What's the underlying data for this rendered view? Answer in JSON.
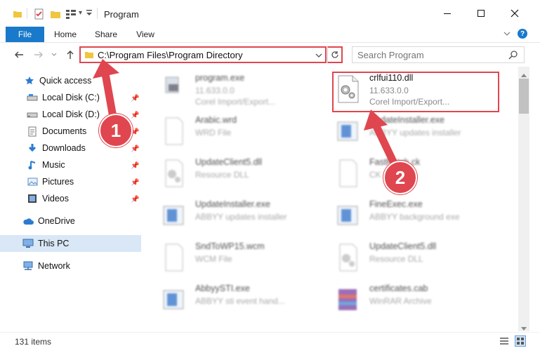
{
  "window": {
    "title": "Program",
    "qa_dropdown": "▾"
  },
  "ribbon": {
    "tabs": [
      {
        "label": "File"
      },
      {
        "label": "Home"
      },
      {
        "label": "Share"
      },
      {
        "label": "View"
      }
    ]
  },
  "address": {
    "path": "C:\\Program Files\\Program Directory"
  },
  "search": {
    "placeholder": "Search Program"
  },
  "nav": {
    "items": [
      {
        "label": "Quick access",
        "icon": "star-icon"
      },
      {
        "label": "Local Disk (C:)",
        "icon": "drive-icon"
      },
      {
        "label": "Local Disk (D:)",
        "icon": "drive-icon"
      },
      {
        "label": "Documents",
        "icon": "documents-icon"
      },
      {
        "label": "Downloads",
        "icon": "download-arrow-icon"
      },
      {
        "label": "Music",
        "icon": "music-note-icon"
      },
      {
        "label": "Pictures",
        "icon": "pictures-icon"
      },
      {
        "label": "Videos",
        "icon": "film-icon"
      },
      {
        "label": "OneDrive",
        "icon": "cloud-icon"
      },
      {
        "label": "This PC",
        "icon": "monitor-icon"
      },
      {
        "label": "Network",
        "icon": "network-icon"
      }
    ]
  },
  "files": [
    {
      "name": "program.exe",
      "line1": "11.633.0.0",
      "line2": "Corel Import/Export..."
    },
    {
      "name": "crlfui110.dll",
      "line1": "11.633.0.0",
      "line2": "Corel Import/Export..."
    },
    {
      "name": "Arabic.wrd",
      "line1": "WRD File",
      "line2": ""
    },
    {
      "name": "UpdateInstaller.exe",
      "line1": "ABBYY updates installer",
      "line2": ""
    },
    {
      "name": "UpdateClient5.dll",
      "line1": "Resource DLL",
      "line2": ""
    },
    {
      "name": "FastPatch.ck",
      "line1": "CK File",
      "line2": ""
    },
    {
      "name": "UpdateInstaller.exe",
      "line1": "ABBYY updates installer",
      "line2": ""
    },
    {
      "name": "FineExec.exe",
      "line1": "ABBYY background exe",
      "line2": ""
    },
    {
      "name": "SndToWP15.wcm",
      "line1": "WCM File",
      "line2": ""
    },
    {
      "name": "UpdateClient5.dll",
      "line1": "Resource DLL",
      "line2": ""
    },
    {
      "name": "AbbyySTI.exe",
      "line1": "ABBYY sti event hand...",
      "line2": ""
    },
    {
      "name": "certificates.cab",
      "line1": "WinRAR Archive",
      "line2": ""
    }
  ],
  "callouts": [
    {
      "label": "1"
    },
    {
      "label": "2"
    }
  ],
  "status": {
    "items": "131 items"
  },
  "colors": {
    "accent": "#1979ca",
    "highlight": "#e0464f"
  }
}
